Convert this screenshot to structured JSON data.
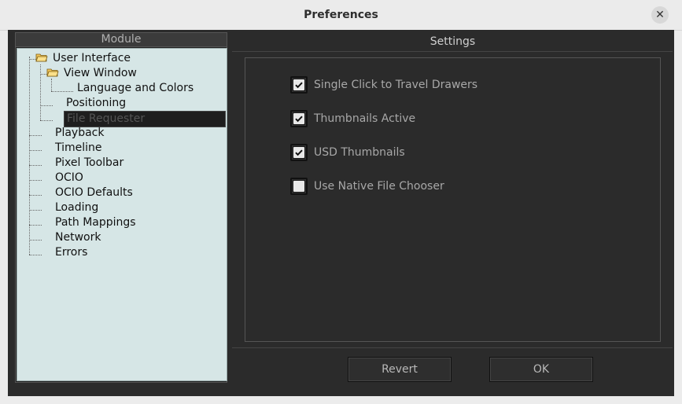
{
  "window": {
    "title": "Preferences",
    "close_glyph": "✕"
  },
  "module_panel": {
    "header": "Module",
    "tree": [
      {
        "label": "User Interface"
      },
      {
        "label": "View Window"
      },
      {
        "label": "Language and Colors"
      },
      {
        "label": "Positioning"
      },
      {
        "label": "File Requester",
        "selected": true
      },
      {
        "label": "Playback"
      },
      {
        "label": "Timeline"
      },
      {
        "label": "Pixel Toolbar"
      },
      {
        "label": "OCIO"
      },
      {
        "label": "OCIO Defaults"
      },
      {
        "label": "Loading"
      },
      {
        "label": "Path Mappings"
      },
      {
        "label": "Network"
      },
      {
        "label": "Errors"
      }
    ]
  },
  "settings": {
    "header": "Settings",
    "options": [
      {
        "label": "Single Click to Travel Drawers",
        "checked": true
      },
      {
        "label": "Thumbnails Active",
        "checked": true
      },
      {
        "label": "USD Thumbnails",
        "checked": true
      },
      {
        "label": "Use Native File Chooser",
        "checked": false
      }
    ]
  },
  "buttons": {
    "revert": "Revert",
    "ok": "OK"
  }
}
